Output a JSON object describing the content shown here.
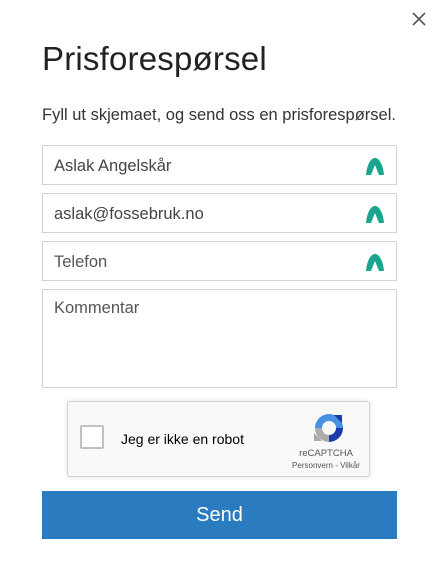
{
  "dialog": {
    "close_icon": "close-icon",
    "title": "Prisforespørsel",
    "subtitle": "Fyll ut skjemaet, og send oss en prisforespørsel."
  },
  "form": {
    "name": {
      "value": "Aslak Angelskår",
      "icon": "lastpass-autofill-icon"
    },
    "email": {
      "value": "aslak@fossebruk.no",
      "icon": "lastpass-autofill-icon"
    },
    "phone": {
      "placeholder": "Telefon",
      "icon": "lastpass-autofill-icon"
    },
    "comment": {
      "placeholder": "Kommentar"
    },
    "icon_color": "#1aa68e",
    "submit_label": "Send",
    "submit_color": "#2a7bbf"
  },
  "captcha": {
    "checkbox_label": "Jeg er ikke en robot",
    "brand": "reCAPTCHA",
    "privacy_link": "Personvern",
    "separator": " - ",
    "terms_link": "Vilkår",
    "logo_icon": "recaptcha-logo-icon"
  }
}
